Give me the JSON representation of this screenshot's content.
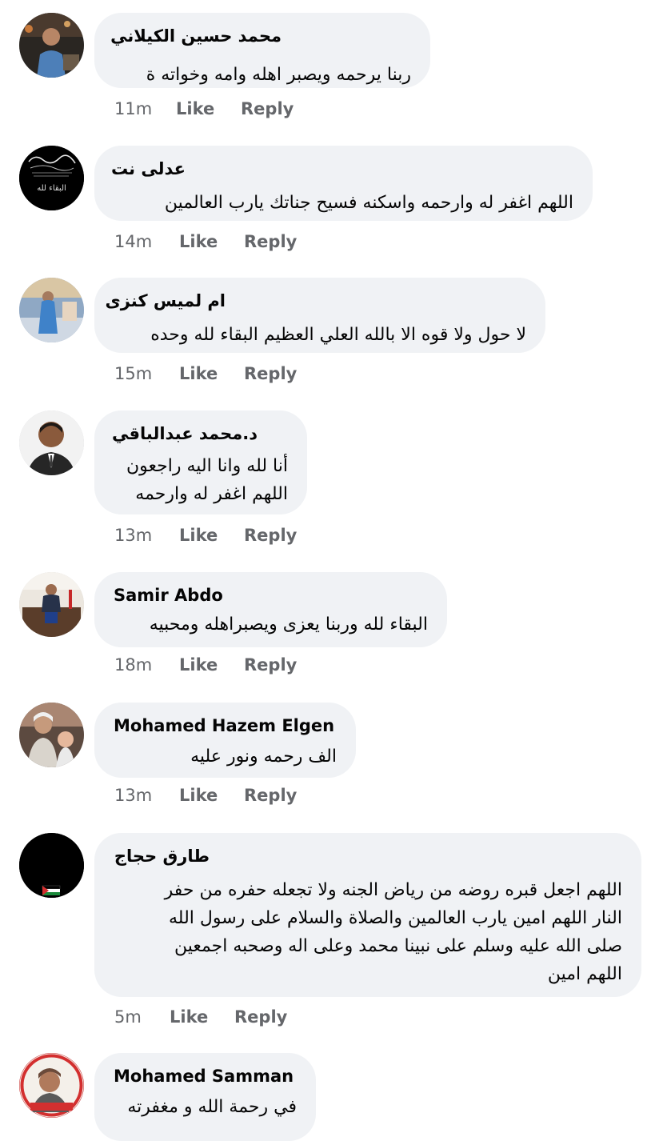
{
  "labels": {
    "like": "Like",
    "reply": "Reply"
  },
  "comments": [
    {
      "author": "محمد حسين الكيلاني",
      "text": "ربنا يرحمه ويصبر اهله وامه وخواته ة",
      "time": "11m",
      "avatar": "profile-photo-man-night"
    },
    {
      "author": "عدلى نت",
      "text": "اللهم اغفر له وارحمه واسكنه فسيح جناتك يارب العالمين",
      "time": "14m",
      "avatar": "condolence-calligraphy",
      "avatar_text": "البقاء لله"
    },
    {
      "author": "ام لميس كنزى",
      "text": "لا حول ولا قوه الا بالله العلي العظيم البقاء لله وحده",
      "time": "15m",
      "avatar": "profile-photo-woman-blue-dress"
    },
    {
      "author": "د.محمد عبدالباقي",
      "text": "أنا لله وانا اليه راجعون\nاللهم اغفر له وارحمه",
      "time": "13m",
      "avatar": "profile-photo-man-suit"
    },
    {
      "author": "Samir Abdo",
      "text": "البقاء لله وربنا يعزى ويصبراهله ومحبيه",
      "time": "18m",
      "avatar": "profile-photo-man-office"
    },
    {
      "author": "Mohamed Hazem Elgen",
      "text": "الف رحمه ونور عليه",
      "time": "13m",
      "avatar": "profile-photo-man-with-baby"
    },
    {
      "author": "طارق حجاج",
      "text": "اللهم اجعل قبره روضه من رياض الجنه ولا تجعله حفره من حفر\nالنار اللهم امين يارب العالمين والصلاة والسلام على رسول الله\nصلى الله عليه وسلم على نبينا محمد وعلى اله وصحبه اجمعين\nاللهم امين",
      "time": "5m",
      "avatar": "black-avatar-with-flag"
    },
    {
      "author": "Mohamed Samman",
      "text": "في رحمة الله و مغفرته",
      "time": "",
      "avatar": "profile-photo-man-red-frame"
    }
  ],
  "colors": {
    "bubble": "#f0f2f5",
    "meta": "#65676b",
    "text": "#050505"
  }
}
